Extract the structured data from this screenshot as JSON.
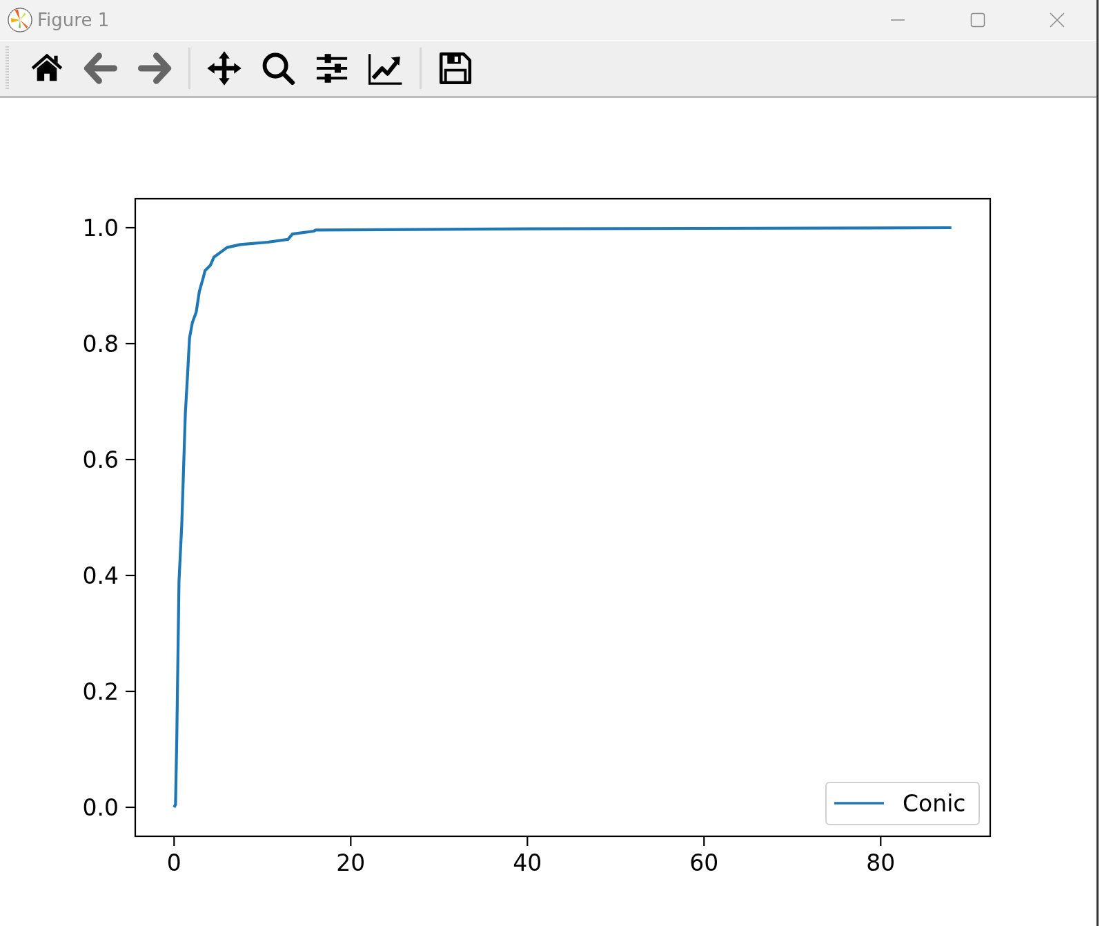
{
  "window": {
    "title": "Figure 1"
  },
  "toolbar": [
    {
      "kind": "home",
      "disabled": false
    },
    {
      "kind": "back",
      "disabled": true
    },
    {
      "kind": "forward",
      "disabled": true
    },
    {
      "kind": "separator"
    },
    {
      "kind": "pan",
      "disabled": false
    },
    {
      "kind": "zoom",
      "disabled": false
    },
    {
      "kind": "subplots",
      "disabled": false
    },
    {
      "kind": "axes",
      "disabled": false
    },
    {
      "kind": "separator"
    },
    {
      "kind": "save",
      "disabled": false
    }
  ],
  "figure": {
    "chart_data": {
      "type": "line",
      "x": [
        0,
        0.16,
        0.3,
        0.55,
        0.87,
        1.27,
        1.5,
        1.75,
        2.06,
        2.5,
        2.86,
        3.3,
        3.5,
        4.1,
        4.5,
        5.2,
        6,
        7.5,
        10.6,
        12.9,
        13.4,
        15.8,
        16,
        40,
        88
      ],
      "series": [
        {
          "name": "Conic",
          "color": "#1f77b4",
          "values": [
            0,
            0.005,
            0.12,
            0.39,
            0.49,
            0.68,
            0.74,
            0.81,
            0.836,
            0.854,
            0.89,
            0.914,
            0.926,
            0.935,
            0.949,
            0.957,
            0.966,
            0.971,
            0.975,
            0.98,
            0.989,
            0.994,
            0.996,
            0.998,
            1.0
          ]
        }
      ],
      "xlim": [
        -4.4,
        92.4
      ],
      "ylim": [
        -0.05,
        1.05
      ],
      "xticks": [
        0,
        20,
        40,
        60,
        80
      ],
      "yticks": [
        {
          "value": 0,
          "label": "0.0"
        },
        {
          "value": 0.2,
          "label": "0.2"
        },
        {
          "value": 0.4,
          "label": "0.4"
        },
        {
          "value": 0.6,
          "label": "0.6"
        },
        {
          "value": 0.8,
          "label": "0.8"
        },
        {
          "value": 1.0,
          "label": "1.0"
        }
      ]
    }
  }
}
